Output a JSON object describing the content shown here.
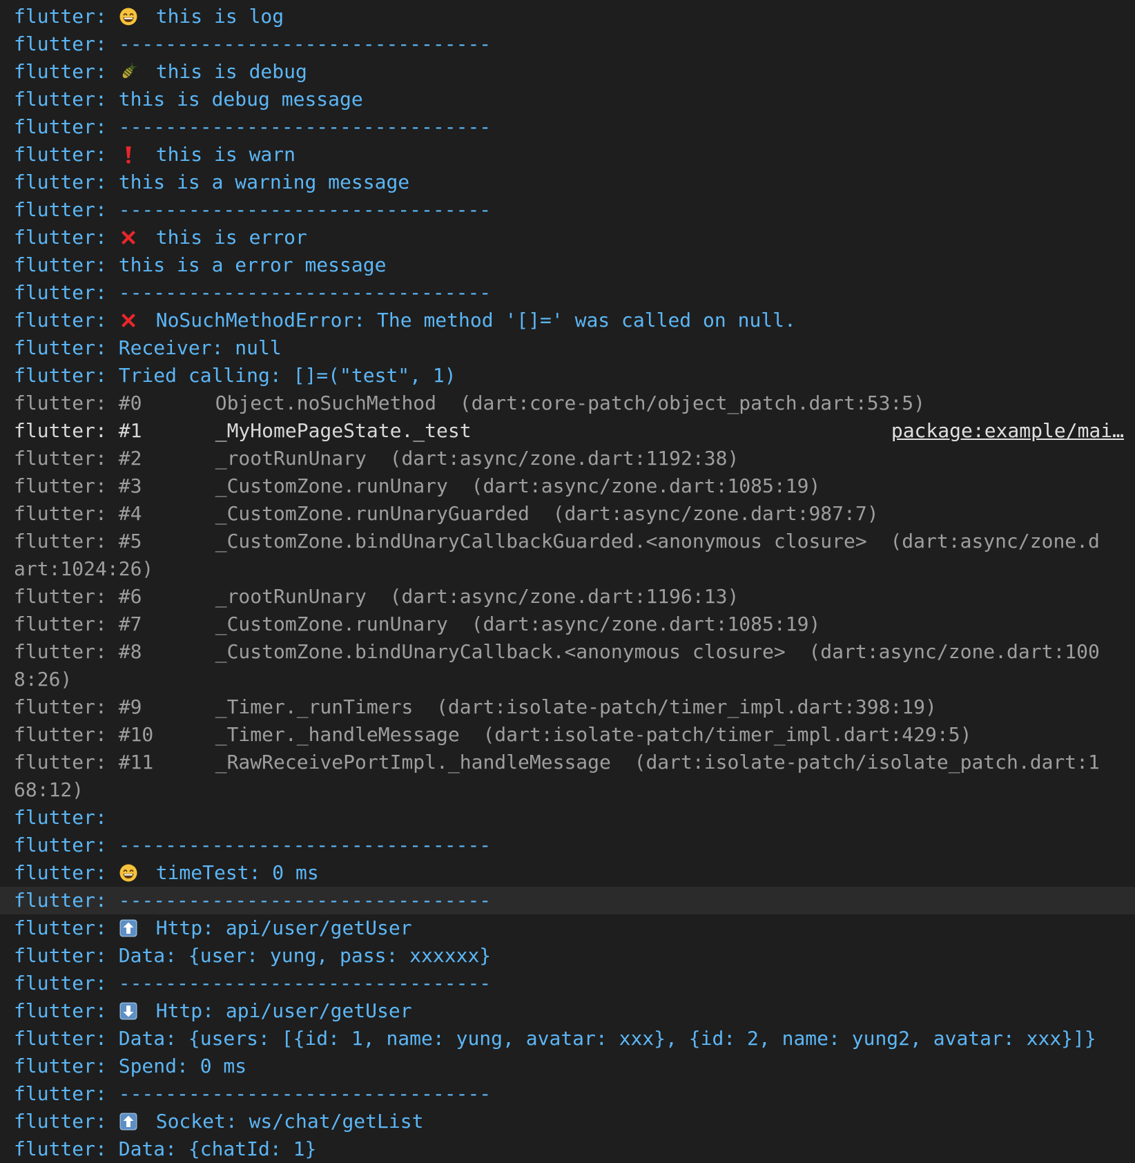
{
  "prefix": "flutter:",
  "lines": [
    {
      "prefix": "flutter:",
      "icon": "grinning-face-icon",
      "text": "this is log",
      "kind": "msg"
    },
    {
      "prefix": "flutter:",
      "text": "--------------------------------",
      "kind": "msg"
    },
    {
      "prefix": "flutter:",
      "icon": "bug-icon",
      "text": "this is debug",
      "kind": "msg"
    },
    {
      "prefix": "flutter:",
      "text": "this is debug message",
      "kind": "msg"
    },
    {
      "prefix": "flutter:",
      "text": "--------------------------------",
      "kind": "msg"
    },
    {
      "prefix": "flutter:",
      "icon": "exclamation-icon",
      "text": "this is warn",
      "kind": "msg"
    },
    {
      "prefix": "flutter:",
      "text": "this is a warning message",
      "kind": "msg"
    },
    {
      "prefix": "flutter:",
      "text": "--------------------------------",
      "kind": "msg"
    },
    {
      "prefix": "flutter:",
      "icon": "cross-mark-icon",
      "text": "this is error",
      "kind": "msg"
    },
    {
      "prefix": "flutter:",
      "text": "this is a error message",
      "kind": "msg"
    },
    {
      "prefix": "flutter:",
      "text": "--------------------------------",
      "kind": "msg"
    },
    {
      "prefix": "flutter:",
      "icon": "cross-mark-icon",
      "text": "NoSuchMethodError: The method '[]=' was called on null.",
      "kind": "msg"
    },
    {
      "prefix": "flutter:",
      "text": "Receiver: null",
      "kind": "msg"
    },
    {
      "prefix": "flutter:",
      "text": "Tried calling: []=(\"test\", 1)",
      "kind": "msg"
    },
    {
      "prefix": "flutter:",
      "frame": "#0",
      "text": "Object.noSuchMethod  (dart:core-patch/object_patch.dart:53:5)",
      "kind": "trace"
    },
    {
      "prefix": "flutter:",
      "frame": "#1",
      "text": "_MyHomePageState._test",
      "link": "package:example/mai…",
      "kind": "trace-bright"
    },
    {
      "prefix": "flutter:",
      "frame": "#2",
      "text": "_rootRunUnary  (dart:async/zone.dart:1192:38)",
      "kind": "trace"
    },
    {
      "prefix": "flutter:",
      "frame": "#3",
      "text": "_CustomZone.runUnary  (dart:async/zone.dart:1085:19)",
      "kind": "trace"
    },
    {
      "prefix": "flutter:",
      "frame": "#4",
      "text": "_CustomZone.runUnaryGuarded  (dart:async/zone.dart:987:7)",
      "kind": "trace"
    },
    {
      "prefix": "flutter:",
      "frame": "#5",
      "text": "_CustomZone.bindUnaryCallbackGuarded.<anonymous closure>  (dart:async/zone.d",
      "kind": "trace"
    },
    {
      "text": "art:1024:26)",
      "kind": "cont"
    },
    {
      "prefix": "flutter:",
      "frame": "#6",
      "text": "_rootRunUnary  (dart:async/zone.dart:1196:13)",
      "kind": "trace"
    },
    {
      "prefix": "flutter:",
      "frame": "#7",
      "text": "_CustomZone.runUnary  (dart:async/zone.dart:1085:19)",
      "kind": "trace"
    },
    {
      "prefix": "flutter:",
      "frame": "#8",
      "text": "_CustomZone.bindUnaryCallback.<anonymous closure>  (dart:async/zone.dart:100",
      "kind": "trace"
    },
    {
      "text": "8:26)",
      "kind": "cont"
    },
    {
      "prefix": "flutter:",
      "frame": "#9",
      "text": "_Timer._runTimers  (dart:isolate-patch/timer_impl.dart:398:19)",
      "kind": "trace"
    },
    {
      "prefix": "flutter:",
      "frame": "#10",
      "text": "_Timer._handleMessage  (dart:isolate-patch/timer_impl.dart:429:5)",
      "kind": "trace"
    },
    {
      "prefix": "flutter:",
      "frame": "#11",
      "text": "_RawReceivePortImpl._handleMessage  (dart:isolate-patch/isolate_patch.dart:1",
      "kind": "trace"
    },
    {
      "text": "68:12)",
      "kind": "cont"
    },
    {
      "prefix": "flutter:",
      "text": "",
      "kind": "msg"
    },
    {
      "prefix": "flutter:",
      "text": "--------------------------------",
      "kind": "msg"
    },
    {
      "prefix": "flutter:",
      "icon": "grinning-face-icon",
      "text": "timeTest: 0 ms",
      "kind": "msg"
    },
    {
      "prefix": "flutter:",
      "text": "--------------------------------",
      "kind": "msg",
      "highlight": true
    },
    {
      "prefix": "flutter:",
      "icon": "up-arrow-icon",
      "text": "Http: api/user/getUser",
      "kind": "msg"
    },
    {
      "prefix": "flutter:",
      "text": "Data: {user: yung, pass: xxxxxx}",
      "kind": "msg"
    },
    {
      "prefix": "flutter:",
      "text": "--------------------------------",
      "kind": "msg"
    },
    {
      "prefix": "flutter:",
      "icon": "down-arrow-icon",
      "text": "Http: api/user/getUser",
      "kind": "msg"
    },
    {
      "prefix": "flutter:",
      "text": "Data: {users: [{id: 1, name: yung, avatar: xxx}, {id: 2, name: yung2, avatar: xxx}]}",
      "kind": "msg"
    },
    {
      "prefix": "flutter:",
      "text": "Spend: 0 ms",
      "kind": "msg"
    },
    {
      "prefix": "flutter:",
      "text": "--------------------------------",
      "kind": "msg"
    },
    {
      "prefix": "flutter:",
      "icon": "up-arrow-icon",
      "text": "Socket: ws/chat/getList",
      "kind": "msg"
    },
    {
      "prefix": "flutter:",
      "text": "Data: {chatId: 1}",
      "kind": "msg"
    }
  ],
  "colors": {
    "background": "#1e1e1e",
    "message": "#5cb6f5",
    "trace": "#9e9e9e",
    "trace_bright": "#d8d8d8",
    "highlight_row": "#2b2b2b",
    "error_icon": "#e8262b",
    "emoji_face": "#f7c23b"
  }
}
